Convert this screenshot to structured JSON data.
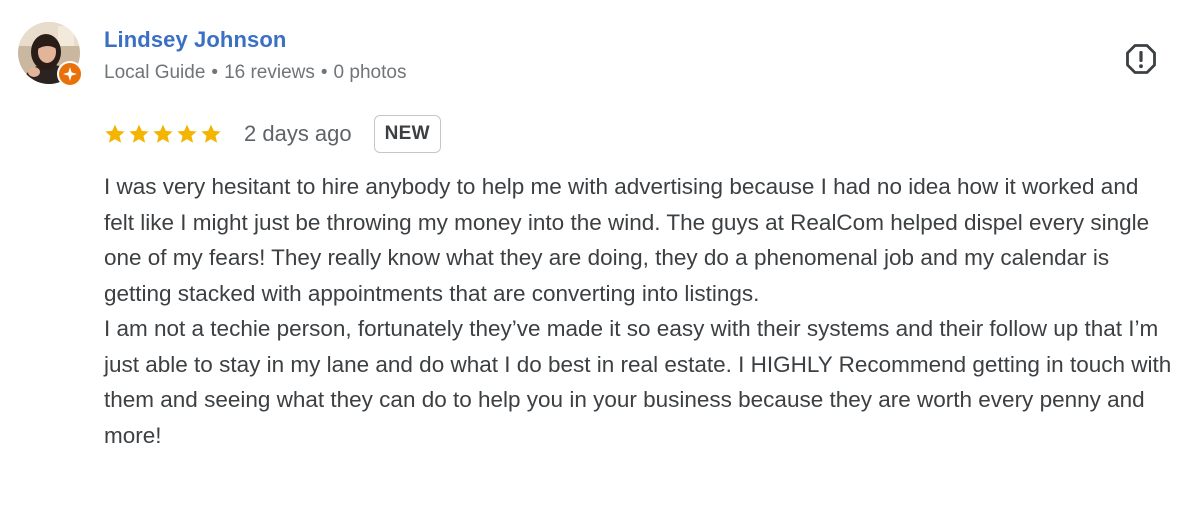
{
  "reviewer": {
    "name": "Lindsey Johnson",
    "role": "Local Guide",
    "reviews": "16 reviews",
    "photos": "0 photos",
    "separator": "•"
  },
  "review": {
    "rating": 5,
    "max_rating": 5,
    "timestamp": "2 days ago",
    "badge": "NEW",
    "paragraphs": [
      "I was very hesitant to hire anybody to help me with advertising because I had no idea how it worked and felt like I might just be throwing my money into the wind. The guys at RealCom helped dispel every single one of my fears! They really know what they are doing, they do a phenomenal job and my calendar is getting stacked with appointments that are converting into listings.",
      "I am not a techie person, fortunately they’ve made it so easy with their systems and their follow up that I’m just able to stay in my lane and do what I do best in real estate. I HIGHLY Recommend getting in touch with them and seeing what they can do to help you in your business because they are worth every penny and more!"
    ]
  },
  "icons": {
    "report": "report-flag-icon",
    "local_guide": "local-guide-star-icon",
    "star": "star-icon"
  },
  "colors": {
    "name": "#3a6fc4",
    "star": "#f4b400",
    "guide_badge": "#e8710a",
    "meta_text": "#70757a",
    "body_text": "#3c4043"
  }
}
